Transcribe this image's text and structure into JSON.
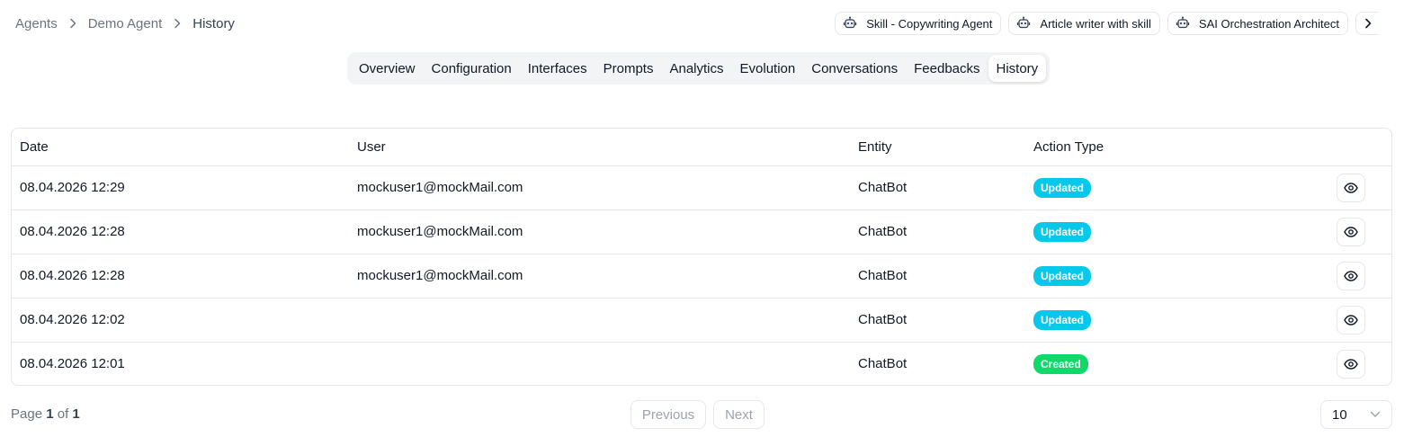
{
  "breadcrumb": {
    "items": [
      "Agents",
      "Demo Agent",
      "History"
    ]
  },
  "chips": [
    {
      "label": "Skill - Copywriting Agent",
      "icon": "robot-icon"
    },
    {
      "label": "Article writer with skill",
      "icon": "robot-icon"
    },
    {
      "label": "SAI Orchestration Architect",
      "icon": "robot-icon"
    }
  ],
  "tabs": [
    {
      "label": "Overview"
    },
    {
      "label": "Configuration"
    },
    {
      "label": "Interfaces"
    },
    {
      "label": "Prompts"
    },
    {
      "label": "Analytics"
    },
    {
      "label": "Evolution"
    },
    {
      "label": "Conversations"
    },
    {
      "label": "Feedbacks"
    },
    {
      "label": "History",
      "active": true
    }
  ],
  "table": {
    "headers": {
      "date": "Date",
      "user": "User",
      "entity": "Entity",
      "action_type": "Action Type"
    },
    "rows": [
      {
        "date": "08.04.2026 12:29",
        "user": "mockuser1@mockMail.com",
        "entity": "ChatBot",
        "action": "Updated"
      },
      {
        "date": "08.04.2026 12:28",
        "user": "mockuser1@mockMail.com",
        "entity": "ChatBot",
        "action": "Updated"
      },
      {
        "date": "08.04.2026 12:28",
        "user": "mockuser1@mockMail.com",
        "entity": "ChatBot",
        "action": "Updated"
      },
      {
        "date": "08.04.2026 12:02",
        "user": "",
        "entity": "ChatBot",
        "action": "Updated"
      },
      {
        "date": "08.04.2026 12:01",
        "user": "",
        "entity": "ChatBot",
        "action": "Created"
      }
    ]
  },
  "pagination": {
    "page_label": "Page",
    "current": "1",
    "of_label": "of",
    "total": "1",
    "previous_label": "Previous",
    "next_label": "Next",
    "page_size": "10"
  },
  "colors": {
    "updated_badge": "#06c8ea",
    "created_badge": "#10d96a",
    "border": "#e5e7eb",
    "tabs_bg": "#f3f4f6"
  }
}
